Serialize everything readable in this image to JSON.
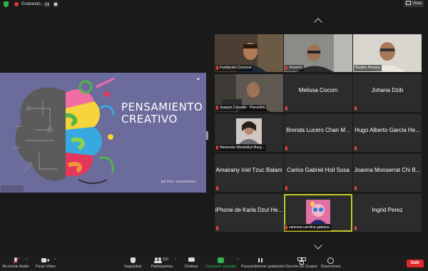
{
  "topbar": {
    "recording_label": "Grabando...",
    "view_label": "Vista"
  },
  "slide": {
    "title_line1": "Pensamiento",
    "title_line2": "creativo",
    "author": "Betnía Gerónima",
    "colors": {
      "background": "#6b6b9c",
      "brain_gray": "#5b5b5b"
    }
  },
  "tiles": [
    {
      "label": "Fundación Cozumel",
      "type": "video",
      "muted": true
    },
    {
      "label": "VictorFC",
      "type": "video",
      "muted": true
    },
    {
      "label": "Heyden Herrera",
      "type": "video",
      "muted": false
    },
    {
      "label": "Joaquin Calzada - Planestra",
      "type": "video",
      "muted": true
    },
    {
      "name": "Melissa Cocom",
      "type": "name",
      "muted": true
    },
    {
      "name": "Johana Dzib",
      "type": "name",
      "muted": true
    },
    {
      "label": "Nemessis Wendollyn Burg...",
      "type": "avatar",
      "muted": true
    },
    {
      "name": "Brenda Lucero Chan M...",
      "type": "name",
      "muted": true
    },
    {
      "name": "Hugo Alberto García He...",
      "type": "name",
      "muted": true
    },
    {
      "name": "Amairany Iriel Tzuc Balam",
      "type": "name",
      "muted": true
    },
    {
      "name": "Carlos Gabriel Hoil Sosa",
      "type": "name",
      "muted": true
    },
    {
      "name": "Joanna Monserrat Chi B...",
      "type": "name",
      "muted": true
    },
    {
      "name": "iPhone de Karla Dzul He...",
      "type": "name",
      "muted": true
    },
    {
      "label": "vanessa carolina galeana",
      "type": "avatar",
      "muted": true,
      "active_speaker": true
    },
    {
      "name": "Ingrid Perez",
      "type": "name",
      "muted": true
    }
  ],
  "toolbar": {
    "unmute": "Re-iniciar Audio",
    "stop_video": "Parar Video",
    "security": "Seguridad",
    "participants": "Participantes",
    "participants_count": "110",
    "chat": "Chatear",
    "share": "Compartir pantalla",
    "record": "Pausar/detener grabación",
    "breakout": "Sección de Grupos",
    "reactions": "Reacciones",
    "leave": "Salir"
  },
  "colors": {
    "accent_green": "#2fb24a",
    "mute_red": "#e14141",
    "leave_red": "#e02828",
    "active_border": "#c6c92c"
  }
}
